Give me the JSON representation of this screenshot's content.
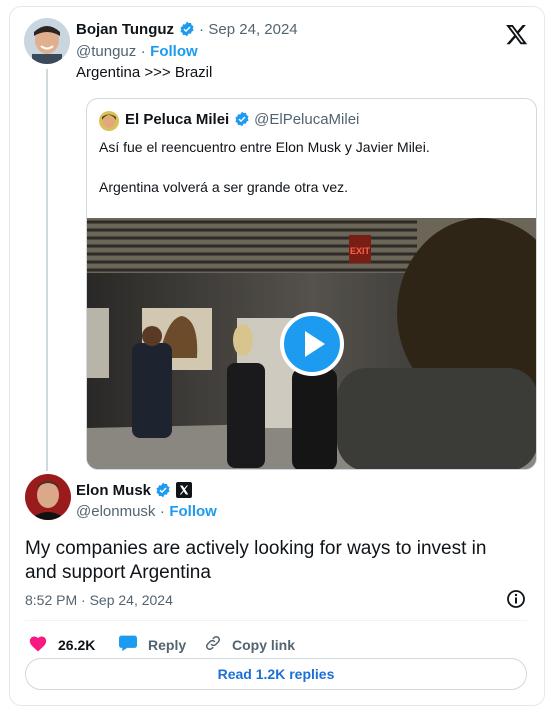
{
  "embed": {
    "quoting_tweet": {
      "author_name": "Bojan Tunguz",
      "date": "Sep 24, 2024",
      "handle": "@tunguz",
      "separator": "·",
      "follow_label": "Follow",
      "text": "Argentina >>> Brazil"
    },
    "quoted_tweet": {
      "author_name": "El Peluca Milei",
      "handle": "@ElPelucaMilei",
      "text_line_1": "Así fue el reencuentro entre Elon Musk y Javier Milei.",
      "text_line_2": "Argentina volverá a ser grande otra vez.",
      "media": {
        "type": "video",
        "sign_text": "EXIT"
      }
    },
    "reply_tweet": {
      "author_name": "Elon Musk",
      "handle": "@elonmusk",
      "separator": "·",
      "follow_label": "Follow",
      "text_line_1": "My companies are actively looking for ways to invest in",
      "text_line_2": "and support Argentina",
      "timestamp": "8:52 PM · Sep 24, 2024"
    },
    "actions": {
      "likes_count": "26.2K",
      "reply_label": "Reply",
      "copy_link_label": "Copy link"
    },
    "read_replies_label": "Read 1.2K replies"
  },
  "colors": {
    "brand_blue": "#1d9bf0",
    "heart": "#f91880",
    "muted": "#536471",
    "border": "#cfd9de"
  }
}
